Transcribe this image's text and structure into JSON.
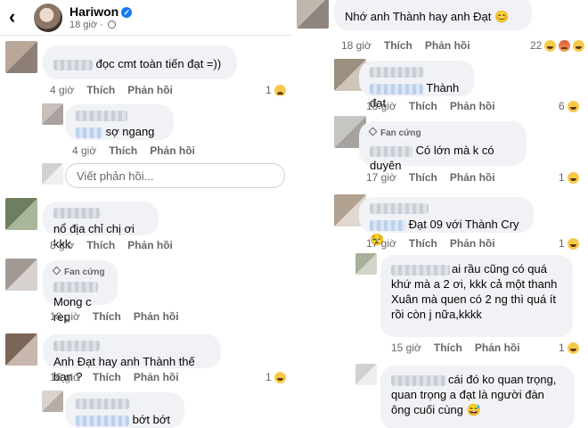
{
  "header": {
    "back_icon": "back-arrow-icon",
    "name": "Hariwon",
    "time": "18 giờ",
    "verified_icon": "verified-badge-icon",
    "privacy_icon": "globe-icon"
  },
  "actions": {
    "like": "Thích",
    "reply": "Phản hồi"
  },
  "fan_badge": "Fan cứng",
  "reply_placeholder": "Viết phản hồi...",
  "left_comments": [
    {
      "text": "đọc cmt toàn tiến đạt =))",
      "time": "4 giờ",
      "reaction_count": "1",
      "reaction_icon": "sad-emoji-icon"
    },
    {
      "text": "sợ ngang",
      "time": "4 giờ"
    },
    {
      "text": "nổ địa chỉ chị ơi kkk",
      "time": "8 giờ"
    },
    {
      "text": "Mong c rep",
      "time": "18 giờ"
    },
    {
      "text": "Anh Đạt hay anh Thành thế bạn ?",
      "time": "16 giờ",
      "reaction_count": "1",
      "reaction_icon": "haha-emoji-icon"
    },
    {
      "text": "bớt bớt lại"
    }
  ],
  "right_comments": [
    {
      "text": "Nhớ anh Thành hay anh Đạt 😊",
      "time": "18 giờ",
      "reaction_count": "22"
    },
    {
      "text": "Thành đạt",
      "time": "18 giờ",
      "reaction_count": "6"
    },
    {
      "text": "Có lớn mà k có duyên",
      "time": "17 giờ",
      "reaction_count": "1"
    },
    {
      "text": "Đạt 09 với Thành Cry 😌",
      "time": "17 giờ",
      "reaction_count": "1"
    },
    {
      "text": "ai rầu cũng có quá khứ mà a 2 ơi, kkk cả một thanh Xuân mà quen có 2 ng thì quá ít rồi còn j nữa,kkkk",
      "time": "15 giờ",
      "reaction_count": "1"
    },
    {
      "text": "cái đó ko quan trọng, quan trọng a đạt là người đàn ông cuối cùng 😅"
    }
  ]
}
